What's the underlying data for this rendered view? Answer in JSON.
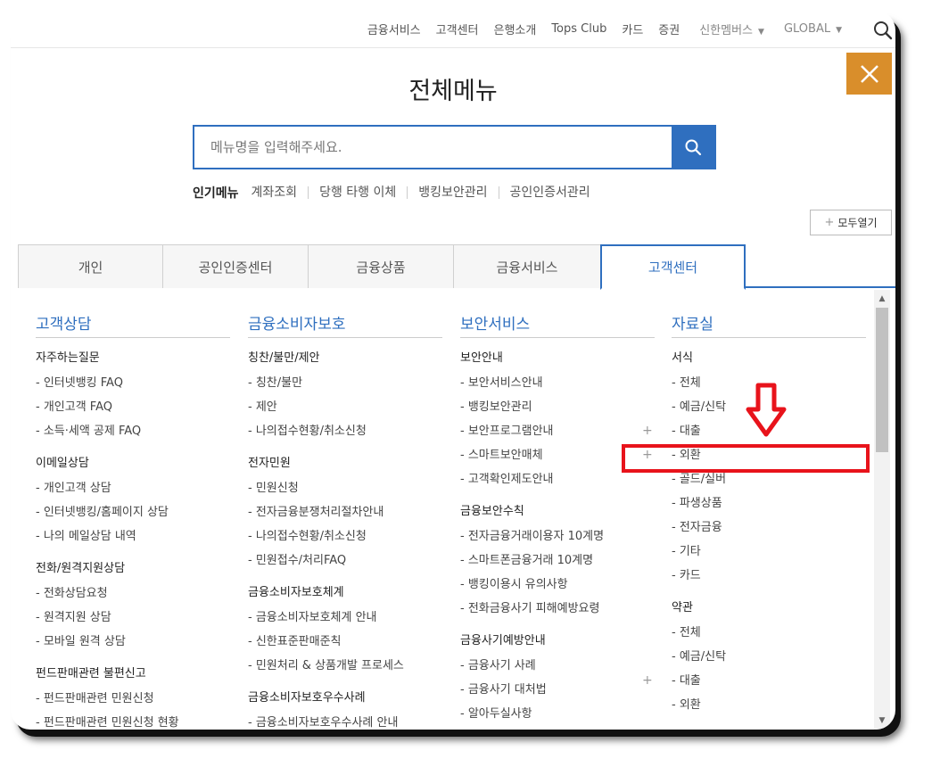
{
  "topnav": {
    "items": [
      "금융서비스",
      "고객센터",
      "은행소개",
      "Tops Club",
      "카드",
      "증권"
    ],
    "members_label": "신한멤버스",
    "global_label": "GLOBAL"
  },
  "title": "전체메뉴",
  "search": {
    "placeholder": "메뉴명을 입력해주세요."
  },
  "popular": {
    "label": "인기메뉴",
    "keywords": [
      "계좌조회",
      "당행 타행 이체",
      "뱅킹보안관리",
      "공인인증서관리"
    ]
  },
  "open_all_label": "모두열기",
  "tabs": [
    "개인",
    "공인인증센터",
    "금융상품",
    "금융서비스",
    "고객센터"
  ],
  "active_tab_index": 4,
  "colors": {
    "accent": "#2f6fbf",
    "close_bg": "#d98e2b",
    "highlight": "#e8131b"
  },
  "columns": [
    {
      "title": "고객상담",
      "groups": [
        {
          "name": "자주하는질문",
          "items": [
            "- 인터넷뱅킹 FAQ",
            "- 개인고객 FAQ",
            "- 소득·세액 공제 FAQ"
          ]
        },
        {
          "name": "이메일상담",
          "items": [
            "- 개인고객 상담",
            "- 인터넷뱅킹/홈페이지 상담",
            "- 나의 메일상담 내역"
          ]
        },
        {
          "name": "전화/원격지원상담",
          "items": [
            "- 전화상담요청",
            "- 원격지원 상담",
            "- 모바일 원격 상담"
          ]
        },
        {
          "name": "펀드판매관련 불편신고",
          "items": [
            "- 펀드판매관련 민원신청",
            "- 펀드판매관련 민원신청 현황"
          ]
        }
      ]
    },
    {
      "title": "금융소비자보호",
      "groups": [
        {
          "name": "칭찬/불만/제안",
          "items": [
            "- 칭찬/불만",
            "- 제안",
            "- 나의접수현황/취소신청"
          ]
        },
        {
          "name": "전자민원",
          "items": [
            "- 민원신청",
            "- 전자금융분쟁처리절차안내",
            "- 나의접수현황/취소신청",
            "- 민원접수/처리FAQ"
          ]
        },
        {
          "name": "금융소비자보호체계",
          "items": [
            "- 금융소비자보호체계 안내",
            "- 신한표준판매준칙",
            "- 민원처리 & 상품개발 프로세스"
          ]
        },
        {
          "name": "금융소비자보호우수사례",
          "items": [
            "- 금융소비자보호우수사례 안내"
          ]
        }
      ]
    },
    {
      "title": "보안서비스",
      "groups": [
        {
          "name": "보안안내",
          "items": [
            "- 보안서비스안내",
            "- 뱅킹보안관리",
            "- 보안프로그램안내",
            "- 스마트보안매체",
            "- 고객확인제도안내"
          ]
        },
        {
          "name": "금융보안수칙",
          "items": [
            "- 전자금융거래이용자 10계명",
            "- 스마트폰금융거래 10계명",
            "- 뱅킹이용시 유의사항",
            "- 전화금융사기 피해예방요령"
          ]
        },
        {
          "name": "금융사기예방안내",
          "items": [
            "- 금융사기 사례",
            "- 금융사기 대처법",
            "- 알아두실사항"
          ]
        }
      ]
    },
    {
      "title": "자료실",
      "groups": [
        {
          "name": "서식",
          "items": [
            "- 전체",
            "- 예금/신탁",
            "- 대출",
            "- 외환",
            "- 골드/실버",
            "- 파생상품",
            "- 전자금융",
            "- 기타",
            "- 카드"
          ]
        },
        {
          "name": "약관",
          "items": [
            "- 전체",
            "- 예금/신탁",
            "- 대출",
            "- 외환"
          ]
        }
      ]
    }
  ]
}
